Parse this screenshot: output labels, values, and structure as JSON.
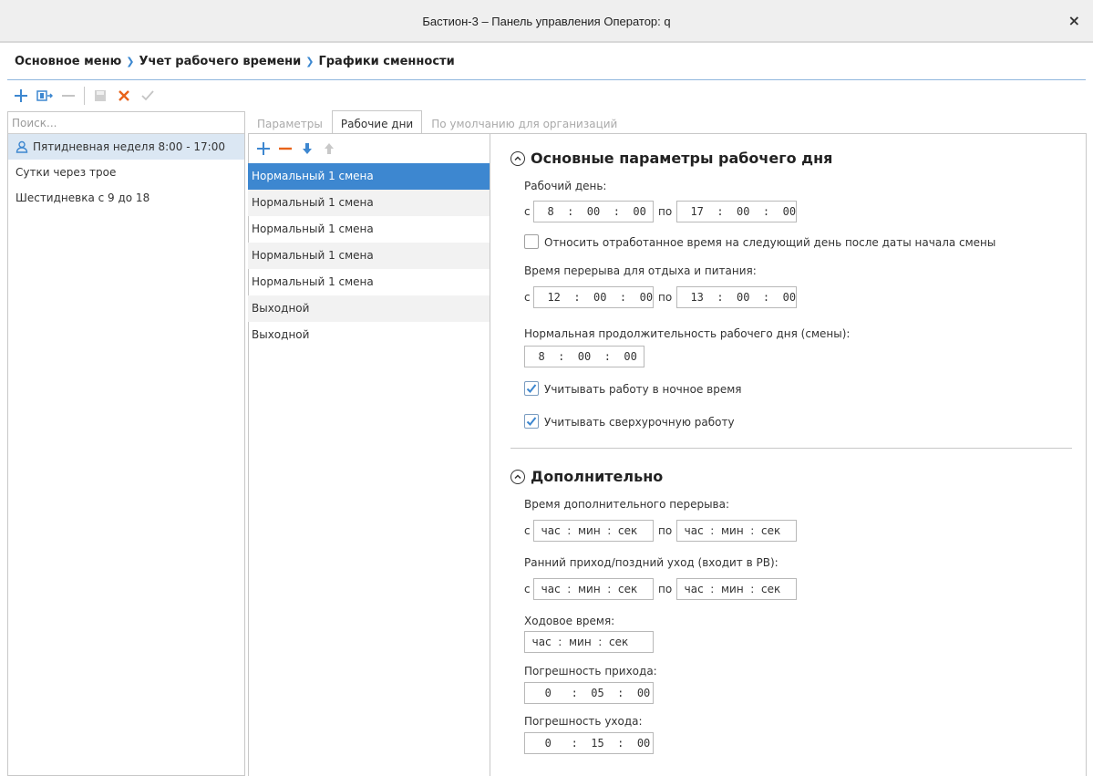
{
  "window": {
    "title": "Бастион-3 – Панель управления Оператор: q",
    "close": "×"
  },
  "breadcrumb": [
    "Основное меню",
    "Учет рабочего времени",
    "Графики сменности"
  ],
  "toolbar": {
    "icons": [
      "plus-icon",
      "copy-icon",
      "minus-icon",
      "save-icon",
      "cancel-icon",
      "check-icon"
    ]
  },
  "sidebar": {
    "search_placeholder": "Поиск...",
    "items": [
      {
        "label": "Пятидневная неделя 8:00 - 17:00",
        "icon": "user-icon",
        "selected": true
      },
      {
        "label": "Сутки через трое"
      },
      {
        "label": "Шестидневка с 9 до 18"
      }
    ]
  },
  "tabs": [
    {
      "label": "Параметры",
      "active": false
    },
    {
      "label": "Рабочие дни",
      "active": true
    },
    {
      "label": "По умолчанию для организаций",
      "active": false
    }
  ],
  "days": {
    "toolbar_icons": [
      "plus-icon",
      "minus-icon",
      "arrow-down-icon",
      "arrow-up-icon"
    ],
    "items": [
      {
        "label": "Нормальный 1 смена",
        "selected": true
      },
      {
        "label": "Нормальный 1 смена"
      },
      {
        "label": "Нормальный 1 смена"
      },
      {
        "label": "Нормальный 1 смена"
      },
      {
        "label": "Нормальный 1 смена"
      },
      {
        "label": "Выходной"
      },
      {
        "label": "Выходной"
      }
    ]
  },
  "main": {
    "title": "Основные параметры рабочего дня",
    "workday_label": "Рабочий день:",
    "from": "с",
    "to": "по",
    "workday_from": "  8  :  00  :  00",
    "workday_to": "  17  :  00  :  00",
    "carry_over_label": "Относить отработанное время на следующий день после даты начала смены",
    "carry_over_checked": false,
    "break_label": "Время перерыва для отдыха и питания:",
    "break_from": "  12  :  00  :  00",
    "break_to": "  13  :  00  :  00",
    "duration_label": "Нормальная продолжительность рабочего дня (смены):",
    "duration_value": "  8  :  00  :  00",
    "night_label": "Учитывать работу в ночное время",
    "night_checked": true,
    "overtime_label": "Учитывать сверхурочную работу",
    "overtime_checked": true
  },
  "additional": {
    "title": "Дополнительно",
    "extra_break_label": "Время дополнительного перерыва:",
    "extra_break_from": "  час  :  мин  :  сек",
    "extra_break_to": "  час  :  мин  :  сек",
    "early_late_label": "Ранний приход/поздний уход (входит в РВ):",
    "early_late_from": "  час  :  мин  :  сек",
    "early_late_to": "  час  :  мин  :  сек",
    "travel_label": "Ходовое время:",
    "travel_value": "  час  :  мин  :  сек",
    "arrival_tol_label": "Погрешность прихода:",
    "arrival_tol_value": "   0   :  05  :  00",
    "departure_tol_label": "Погрешность ухода:",
    "departure_tol_value": "   0   :  15  :  00"
  },
  "colors": {
    "accent": "#3d87d0",
    "orange": "#e8631a",
    "selected_row": "#3d87d0",
    "sidebar_selected": "#dbe7f3"
  }
}
